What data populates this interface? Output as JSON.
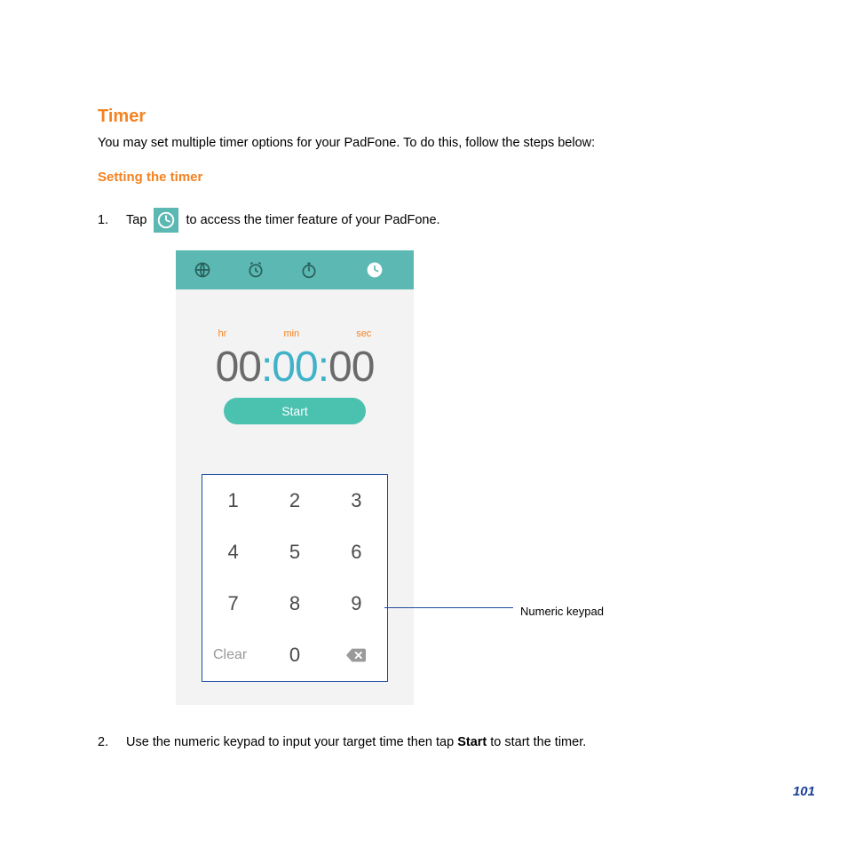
{
  "section_title": "Timer",
  "intro_text": "You may set multiple timer options for your PadFone. To do this, follow the steps below:",
  "subsection_title": "Setting the timer",
  "step1_before": "Tap ",
  "step1_after": " to access the timer feature of your PadFone.",
  "step2_before": "Use the numeric keypad to input your target time then tap ",
  "step2_bold": "Start",
  "step2_after": " to start the timer.",
  "tab_icons": [
    "globe",
    "alarm",
    "stopwatch",
    "timer"
  ],
  "unit_hr": "hr",
  "unit_min": "min",
  "unit_sec": "sec",
  "time_hr": "00",
  "time_min": "00",
  "time_sec": "00",
  "start_label": "Start",
  "keys": [
    "1",
    "2",
    "3",
    "4",
    "5",
    "6",
    "7",
    "8",
    "9"
  ],
  "key_clear": "Clear",
  "key_zero": "0",
  "callout_label": "Numeric keypad",
  "page_number": "101"
}
